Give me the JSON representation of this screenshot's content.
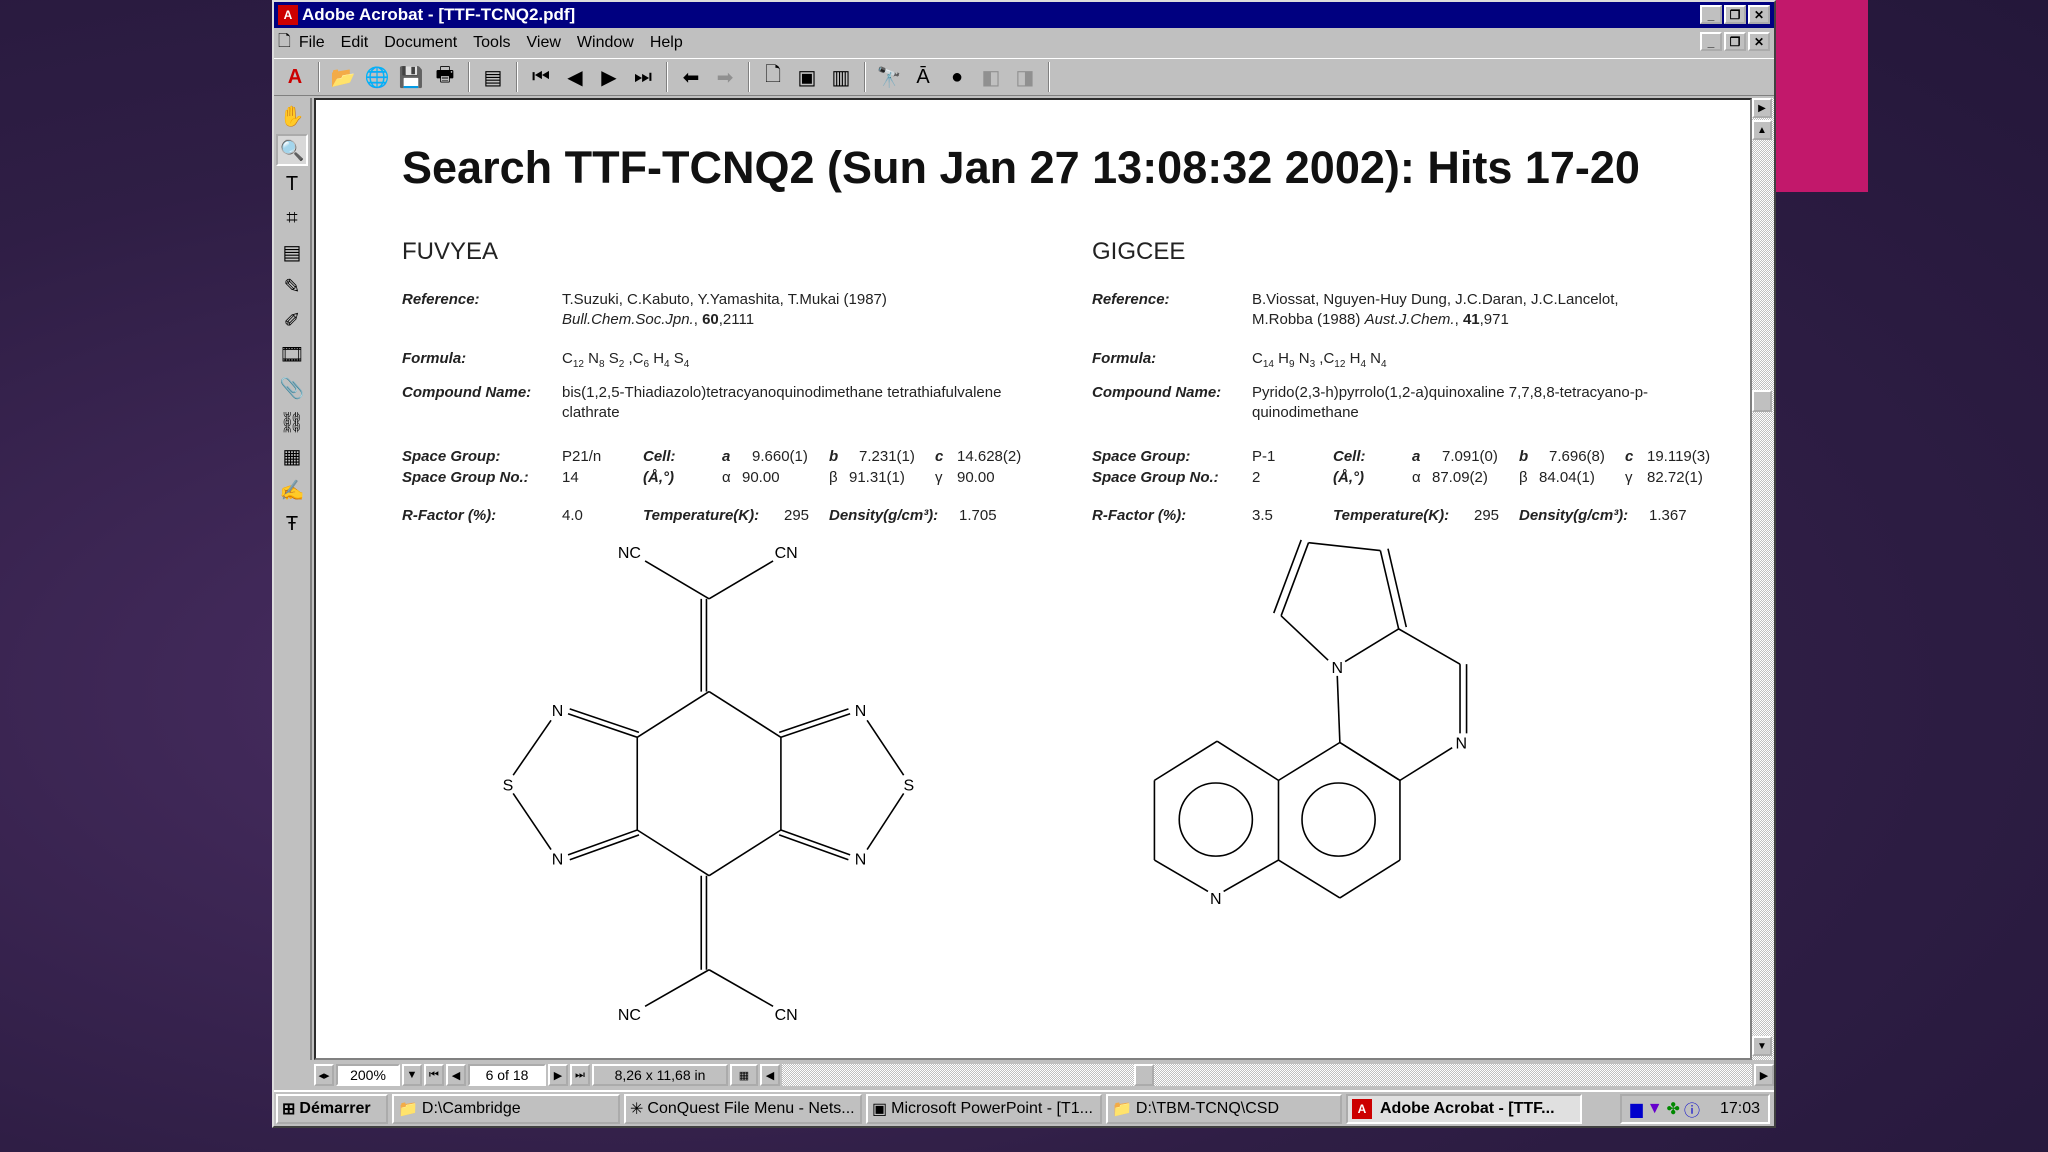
{
  "window": {
    "title": "Adobe Acrobat - [TTF-TCNQ2.pdf]",
    "buttons": [
      "minimize",
      "restore",
      "close"
    ]
  },
  "menu": [
    "File",
    "Edit",
    "Document",
    "Tools",
    "View",
    "Window",
    "Help"
  ],
  "toolbar": [
    "acrobat-logo",
    "open",
    "open-web",
    "save",
    "print",
    "show-bookmarks",
    "first-page",
    "previous-page",
    "next-page",
    "last-page",
    "go-back",
    "go-forward",
    "actual-size",
    "fit-page",
    "fit-width",
    "find",
    "find-again",
    "search",
    "search-previous",
    "search-next"
  ],
  "tools": [
    "hand",
    "zoom",
    "text-select",
    "crop",
    "note",
    "pencil",
    "highlighter",
    "movie",
    "attach",
    "link",
    "form",
    "stamp",
    "touchup-text"
  ],
  "page": {
    "title": "Search TTF-TCNQ2 (Sun Jan 27 13:08:32 2002): Hits 17-20",
    "labels": {
      "reference": "Reference:",
      "formula": "Formula:",
      "compound": "Compound Name:",
      "space_group": "Space Group:",
      "sg_no": "Space Group No.:",
      "rfactor": "R-Factor (%):",
      "cell": "Cell:",
      "cell_units": "(Å,°)",
      "temperature": "Temperature(K):",
      "density": "Density(g/cm³):",
      "a": "a",
      "b": "b",
      "c": "c",
      "alpha": "α",
      "beta": "β",
      "gamma": "γ"
    },
    "entries": [
      {
        "code": "FUVYEA",
        "ref_authors": "T.Suzuki, C.Kabuto, Y.Yamashita, T.Mukai (1987)",
        "ref_journal": "Bull.Chem.Soc.Jpn.",
        "ref_vol": "60",
        "ref_page": ",2111",
        "formula": [
          [
            "C",
            "12"
          ],
          [
            "N",
            "8"
          ],
          [
            "S",
            "2"
          ],
          [
            ",C",
            "6"
          ],
          [
            "H",
            "4"
          ],
          [
            "S",
            "4"
          ]
        ],
        "compound_name": "bis(1,2,5-Thiadiazolo)tetracyanoquinodimethane tetrathiafulvalene clathrate",
        "space_group": "P21/n",
        "sg_no": "14",
        "a": "9.660(1)",
        "b": "7.231(1)",
        "c": "14.628(2)",
        "alpha": "90.00",
        "beta": "91.31(1)",
        "gamma": "90.00",
        "rfactor": "4.0",
        "temperature": "295",
        "density": "1.705",
        "atoms": [
          "NC",
          "CN",
          "N",
          "S",
          "N",
          "N",
          "S",
          "N",
          "NC",
          "CN"
        ]
      },
      {
        "code": "GIGCEE",
        "ref_authors": "B.Viossat, Nguyen-Huy Dung, J.C.Daran, J.C.Lancelot,",
        "ref_line2": "M.Robba (1988) ",
        "ref_journal": "Aust.J.Chem.",
        "ref_vol": "41",
        "ref_page": ",971",
        "formula": [
          [
            "C",
            "14"
          ],
          [
            "H",
            "9"
          ],
          [
            "N",
            "3"
          ],
          [
            ",C",
            "12"
          ],
          [
            "H",
            "4"
          ],
          [
            "N",
            "4"
          ]
        ],
        "compound_name": "Pyrido(2,3-h)pyrrolo(1,2-a)quinoxaline 7,7,8,8-tetracyano-p-quinodimethane",
        "space_group": "P-1",
        "sg_no": "2",
        "a": "7.091(0)",
        "b": "7.696(8)",
        "c": "19.119(3)",
        "alpha": "87.09(2)",
        "beta": "84.04(1)",
        "gamma": "82.72(1)",
        "rfactor": "3.5",
        "temperature": "295",
        "density": "1.367",
        "atoms": [
          "N",
          "N",
          "N"
        ]
      }
    ]
  },
  "status": {
    "zoom": "200%",
    "page": "6 of 18",
    "size": "8,26 x 11,68 in"
  },
  "taskbar": {
    "start": "Démarrer",
    "tasks": [
      "D:\\Cambridge",
      "ConQuest File Menu - Nets...",
      "Microsoft PowerPoint - [T1...",
      "D:\\TBM-TCNQ\\CSD",
      "Adobe Acrobat - [TTF..."
    ],
    "clock": "17:03"
  },
  "colors": {
    "titlebar": "#000080",
    "chrome": "#c0c0c0",
    "accent_pink": "#c2186b"
  }
}
